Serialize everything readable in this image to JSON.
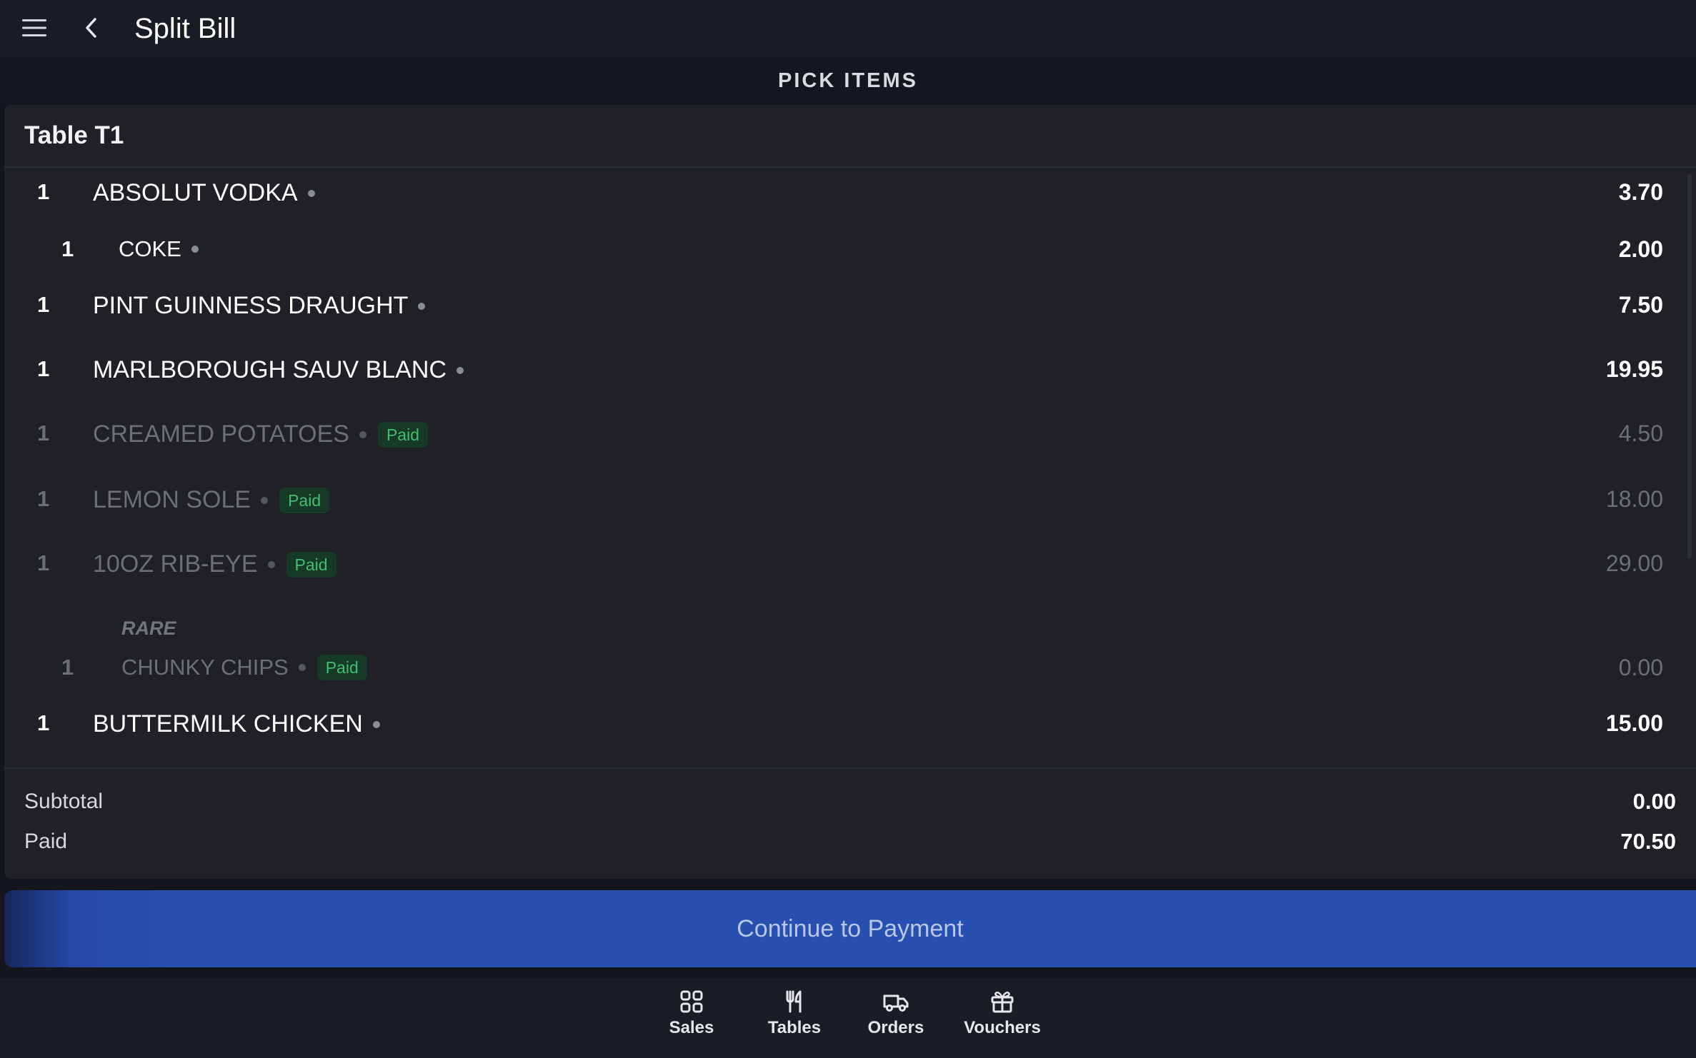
{
  "header": {
    "title": "Split Bill",
    "menu_icon": "hamburger-menu-icon",
    "back_icon": "chevron-left-icon"
  },
  "subheader": {
    "label": "PICK ITEMS"
  },
  "table": {
    "name": "Table T1"
  },
  "items": [
    {
      "qty": "1",
      "name": "ABSOLUT VODKA",
      "price": "3.70",
      "paid": false
    },
    {
      "qty": "1",
      "name": "COKE",
      "price": "2.00",
      "paid": false
    },
    {
      "qty": "1",
      "name": "PINT GUINNESS DRAUGHT",
      "price": "7.50",
      "paid": false
    },
    {
      "qty": "1",
      "name": "MARLBOROUGH SAUV BLANC",
      "price": "19.95",
      "paid": false
    },
    {
      "qty": "1",
      "name": "CREAMED POTATOES",
      "price": "4.50",
      "paid": true,
      "badge": "Paid"
    },
    {
      "qty": "1",
      "name": "LEMON SOLE",
      "price": "18.00",
      "paid": true,
      "badge": "Paid"
    },
    {
      "qty": "1",
      "name": "10OZ RIB-EYE",
      "price": "29.00",
      "paid": true,
      "badge": "Paid"
    },
    {
      "qty": "1",
      "name": "CHUNKY CHIPS",
      "price": "0.00",
      "paid": true,
      "badge": "Paid"
    },
    {
      "qty": "1",
      "name": "BUTTERMILK CHICKEN",
      "price": "15.00",
      "paid": false
    }
  ],
  "modifier": {
    "text": "RARE"
  },
  "totals": {
    "subtotal_label": "Subtotal",
    "subtotal_value": "0.00",
    "paid_label": "Paid",
    "paid_value": "70.50"
  },
  "cta": {
    "label": "Continue to Payment"
  },
  "nav": [
    {
      "label": "Sales",
      "icon": "grid-icon"
    },
    {
      "label": "Tables",
      "icon": "cutlery-icon"
    },
    {
      "label": "Orders",
      "icon": "delivery-truck-icon"
    },
    {
      "label": "Vouchers",
      "icon": "gift-icon"
    }
  ],
  "colors": {
    "accent": "#2850b0",
    "paid_badge_bg": "#163a26",
    "paid_badge_text": "#3fbf6f",
    "background": "#13161d"
  }
}
